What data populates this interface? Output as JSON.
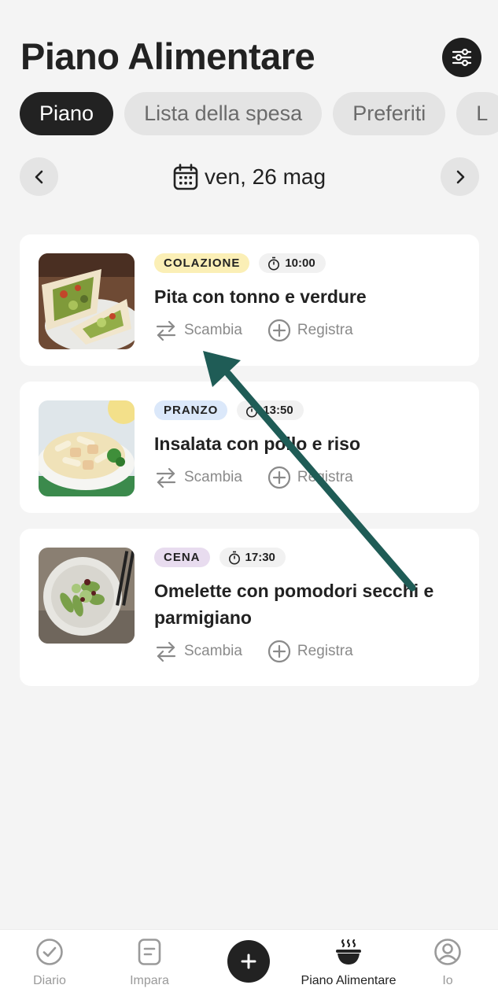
{
  "header": {
    "title": "Piano Alimentare"
  },
  "tabs": [
    {
      "label": "Piano",
      "active": true
    },
    {
      "label": "Lista della spesa",
      "active": false
    },
    {
      "label": "Preferiti",
      "active": false
    },
    {
      "label": "L",
      "active": false
    }
  ],
  "date_nav": {
    "date": "ven, 26 mag"
  },
  "meals": [
    {
      "tag": "COLAZIONE",
      "tag_bg": "#fbefb6",
      "time": "10:00",
      "name": "Pita con tonno e verdure",
      "swap_label": "Scambia",
      "log_label": "Registra"
    },
    {
      "tag": "PRANZO",
      "tag_bg": "#dbe8fa",
      "time": "13:50",
      "name": "Insalata con pollo e riso",
      "swap_label": "Scambia",
      "log_label": "Registra"
    },
    {
      "tag": "CENA",
      "tag_bg": "#e8dcef",
      "time": "17:30",
      "name": "Omelette con pomodori secchi e parmigiano",
      "swap_label": "Scambia",
      "log_label": "Registra"
    }
  ],
  "bottom_nav": {
    "diario": "Diario",
    "impara": "Impara",
    "piano": "Piano Alimentare",
    "io": "Io"
  },
  "colors": {
    "dark": "#222222",
    "annotation_arrow": "#1f5c56"
  }
}
